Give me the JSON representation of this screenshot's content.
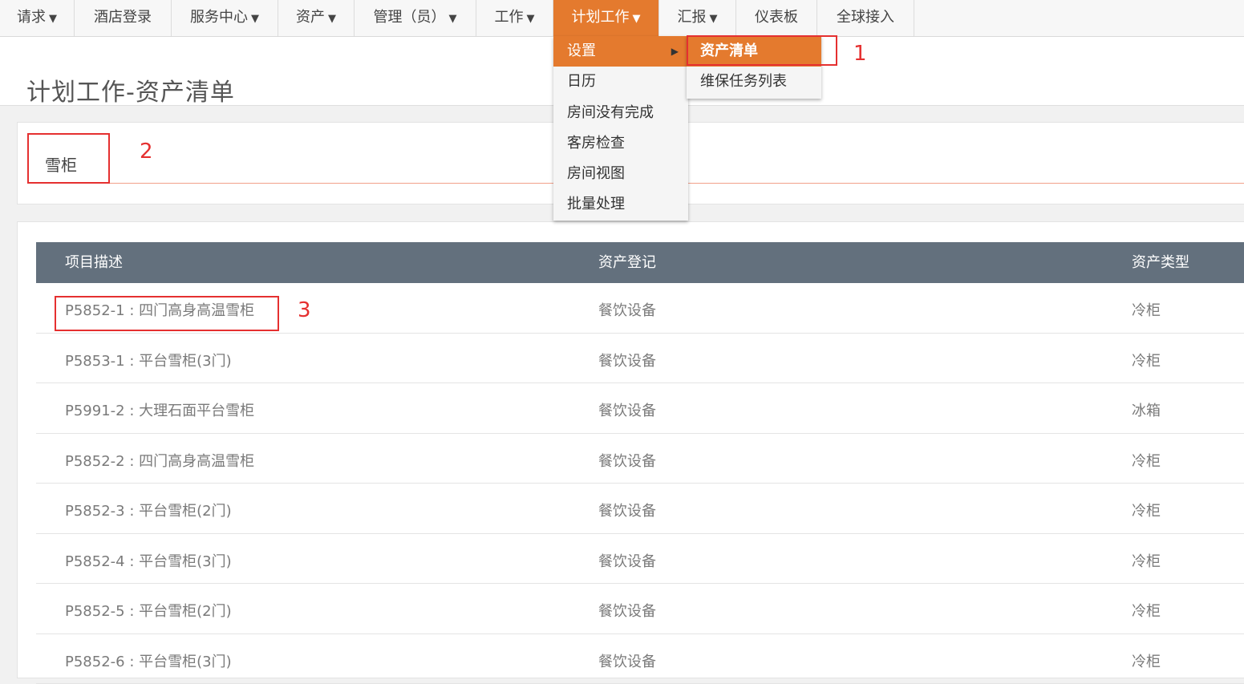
{
  "nav": {
    "items": [
      {
        "label": "请求",
        "arrow": "▼"
      },
      {
        "label": "酒店登录",
        "arrow": ""
      },
      {
        "label": "服务中心",
        "arrow": "▼"
      },
      {
        "label": "资产",
        "arrow": "▼"
      },
      {
        "label": "管理（员）",
        "arrow": "▼"
      },
      {
        "label": "工作",
        "arrow": "▼"
      },
      {
        "label": "计划工作",
        "arrow": "▼"
      },
      {
        "label": "汇报",
        "arrow": "▼"
      },
      {
        "label": "仪表板",
        "arrow": ""
      },
      {
        "label": "全球接入",
        "arrow": ""
      }
    ]
  },
  "page": {
    "title": "计划工作-资产清单"
  },
  "search": {
    "value": "雪柜"
  },
  "dropdown": {
    "items": [
      "设置",
      "日历",
      "房间没有完成",
      "客房检查",
      "房间视图",
      "批量处理"
    ],
    "submenu_arrow": "▶"
  },
  "submenu": {
    "items": [
      "资产清单",
      "维保任务列表"
    ]
  },
  "table": {
    "headers": [
      "项目描述",
      "资产登记",
      "资产类型"
    ],
    "rows": [
      [
        "P5852-1 : 四门高身高温雪柜",
        "餐饮设备",
        "冷柜"
      ],
      [
        "P5853-1 : 平台雪柜(3门)",
        "餐饮设备",
        "冷柜"
      ],
      [
        "P5991-2 : 大理石面平台雪柜",
        "餐饮设备",
        "冰箱"
      ],
      [
        "P5852-2 : 四门高身高温雪柜",
        "餐饮设备",
        "冷柜"
      ],
      [
        "P5852-3 : 平台雪柜(2门)",
        "餐饮设备",
        "冷柜"
      ],
      [
        "P5852-4 : 平台雪柜(3门)",
        "餐饮设备",
        "冷柜"
      ],
      [
        "P5852-5 : 平台雪柜(2门)",
        "餐饮设备",
        "冷柜"
      ],
      [
        "P5852-6 : 平台雪柜(3门)",
        "餐饮设备",
        "冷柜"
      ]
    ]
  },
  "annotations": [
    "1",
    "2",
    "3"
  ],
  "colors": {
    "accent": "#e47a2e",
    "header": "#63707d",
    "annotation": "#e53030"
  }
}
